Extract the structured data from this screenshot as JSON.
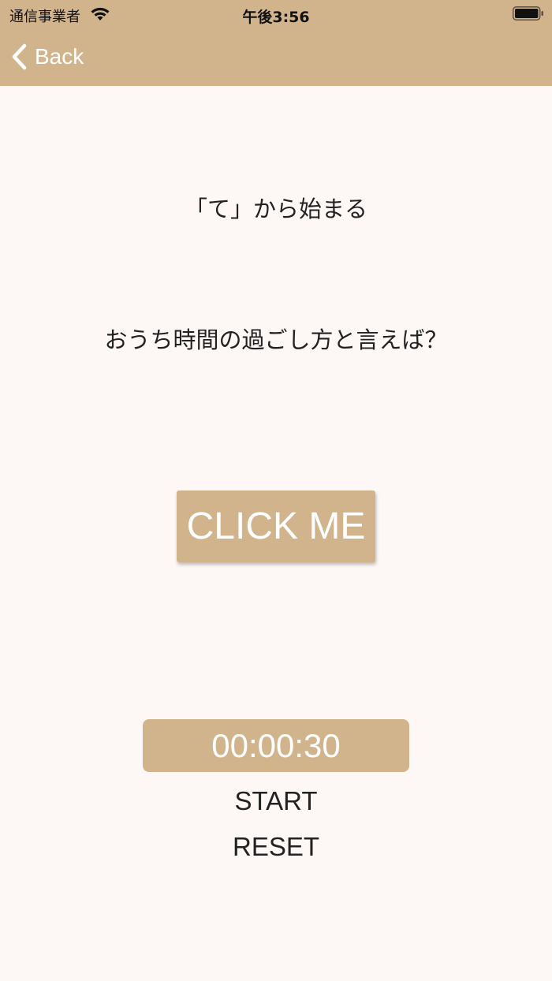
{
  "status_bar": {
    "carrier": "通信事業者",
    "time": "午後3:56",
    "wifi_icon": "wifi-icon",
    "battery_icon": "battery-icon"
  },
  "nav": {
    "back_label": "Back",
    "back_icon": "chevron-left-icon",
    "bar_color": "#D2B48C"
  },
  "main": {
    "prompt_line": "「て」から始まる",
    "question": "おうち時間の過ごし方と言えば？",
    "click_button": "CLICK ME",
    "timer_value": "00:00:30",
    "start_label": "START",
    "reset_label": "RESET",
    "accent_color": "#D2B48C",
    "background_color": "#FDF8F6"
  }
}
